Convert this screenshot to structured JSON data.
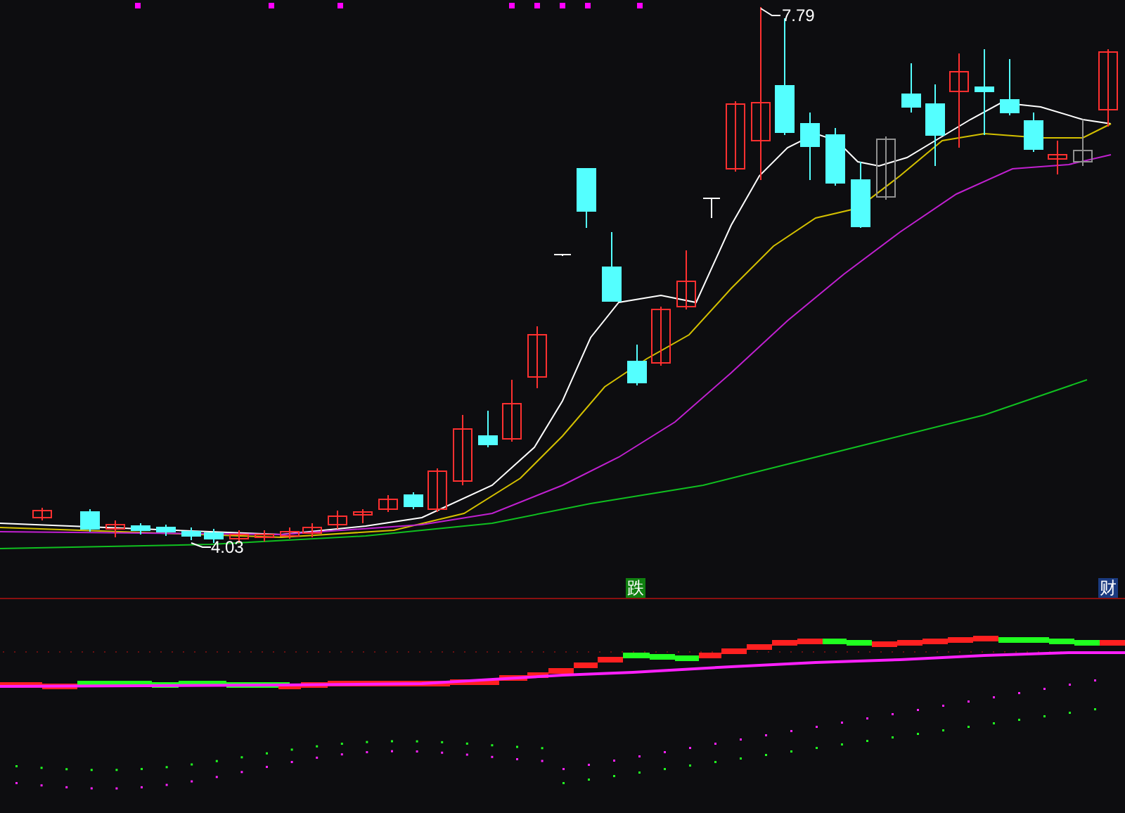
{
  "main_panel": {
    "high_label": "7.79",
    "low_label": "4.03"
  },
  "indicator_panel": {
    "signal_badge": "跌",
    "tab": "财"
  }
}
